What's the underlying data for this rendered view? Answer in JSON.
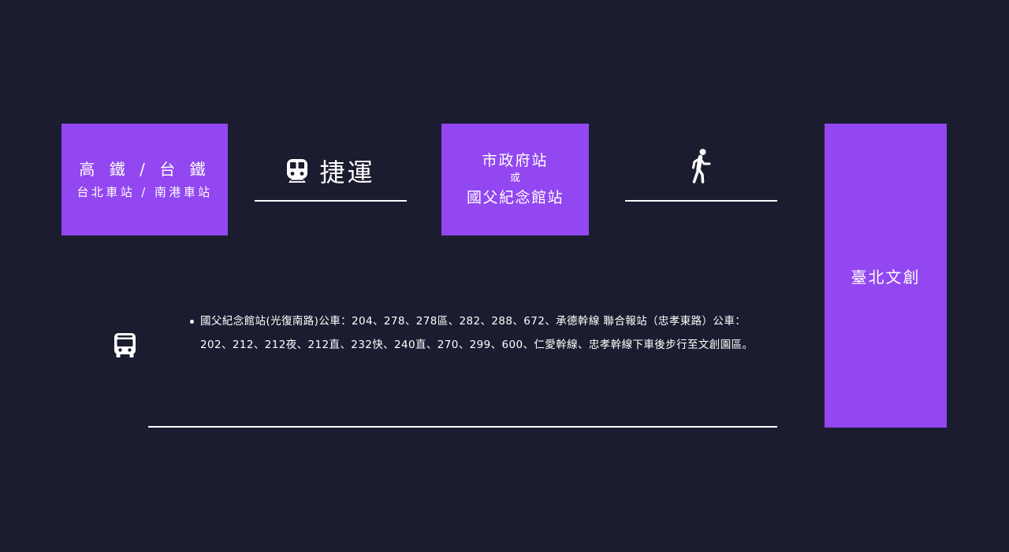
{
  "colors": {
    "background": "#1c1c30",
    "accent": "#9247f0",
    "text": "#ffffff"
  },
  "start": {
    "line1": "高 鐵 / 台 鐵",
    "line2": "台北車站 / 南港車站"
  },
  "mrt": {
    "icon": "subway-icon",
    "label": "捷運"
  },
  "station": {
    "line1": "市政府站",
    "or": "或",
    "line2": "國父紀念館站"
  },
  "walk": {
    "icon": "walking-icon"
  },
  "destination": {
    "label": "臺北文創"
  },
  "bus": {
    "icon": "bus-icon",
    "items": [
      "國父紀念館站(光復南路)公車：204、278、278區、282、288、672、承德幹線 聯合報站（忠孝東路）公車：202、212、212夜、212直、232快、240直、270、299、600、仁愛幹線、忠孝幹線下車後步行至文創園區。"
    ]
  }
}
